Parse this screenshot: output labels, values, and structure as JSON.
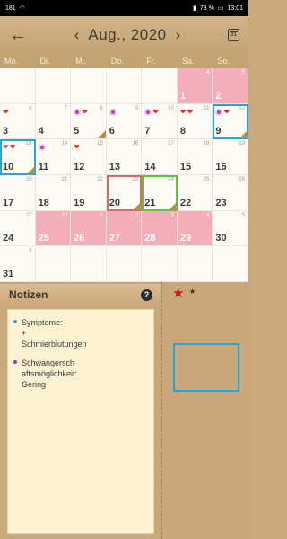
{
  "status_bar": {
    "left_text": "181",
    "battery": "73 %",
    "time": "13:01"
  },
  "header": {
    "month_title": "Aug., 2020",
    "prev": "‹",
    "next": "›",
    "calendar_icon_text": "31",
    "back_icon": "←"
  },
  "weekdays": [
    "Mo.",
    "Di.",
    "Mi.",
    "Do.",
    "Fr.",
    "Sa.",
    "So."
  ],
  "calendar_rows": [
    [
      {
        "day": "",
        "cycle": ""
      },
      {
        "day": "",
        "cycle": ""
      },
      {
        "day": "",
        "cycle": ""
      },
      {
        "day": "",
        "cycle": ""
      },
      {
        "day": "",
        "cycle": ""
      },
      {
        "day": "1",
        "cycle": "4",
        "pink": true
      },
      {
        "day": "2",
        "cycle": "5",
        "pink": true
      }
    ],
    [
      {
        "day": "3",
        "cycle": "6",
        "symbols": [
          "heart"
        ]
      },
      {
        "day": "4",
        "cycle": "7"
      },
      {
        "day": "5",
        "cycle": "8",
        "symbols": [
          "ring",
          "heart"
        ],
        "fold": true
      },
      {
        "day": "6",
        "cycle": "9",
        "symbols": [
          "ring"
        ]
      },
      {
        "day": "7",
        "cycle": "10",
        "symbols": [
          "ring",
          "heart"
        ]
      },
      {
        "day": "8",
        "cycle": "11",
        "symbols": [
          "heart",
          "heart"
        ]
      },
      {
        "day": "9",
        "cycle": "12",
        "symbols": [
          "ring",
          "heart"
        ],
        "fold": true,
        "highlight": "blue"
      }
    ],
    [
      {
        "day": "10",
        "cycle": "13",
        "symbols": [
          "heart-pink",
          "heart"
        ],
        "fold": true,
        "highlight": "blue"
      },
      {
        "day": "11",
        "cycle": "14",
        "symbols": [
          "ring"
        ]
      },
      {
        "day": "12",
        "cycle": "15",
        "symbols": [
          "heart"
        ]
      },
      {
        "day": "13",
        "cycle": "16"
      },
      {
        "day": "14",
        "cycle": "17"
      },
      {
        "day": "15",
        "cycle": "18"
      },
      {
        "day": "16",
        "cycle": "19"
      }
    ],
    [
      {
        "day": "17",
        "cycle": "20"
      },
      {
        "day": "18",
        "cycle": "21"
      },
      {
        "day": "19",
        "cycle": "22"
      },
      {
        "day": "20",
        "cycle": "23",
        "fold": true,
        "highlight": "red"
      },
      {
        "day": "21",
        "cycle": "24",
        "fold": true,
        "highlight": "green"
      },
      {
        "day": "22",
        "cycle": "25"
      },
      {
        "day": "23",
        "cycle": "26"
      }
    ],
    [
      {
        "day": "24",
        "cycle": "27"
      },
      {
        "day": "25",
        "cycle": "28",
        "pink": true
      },
      {
        "day": "26",
        "cycle": "1",
        "pink": true
      },
      {
        "day": "27",
        "cycle": "2",
        "pink": true
      },
      {
        "day": "28",
        "cycle": "3",
        "pink": true
      },
      {
        "day": "29",
        "cycle": "4",
        "pink": true
      },
      {
        "day": "30",
        "cycle": "5"
      }
    ],
    [
      {
        "day": "31",
        "cycle": "6"
      },
      {
        "day": "",
        "cycle": ""
      },
      {
        "day": "",
        "cycle": ""
      },
      {
        "day": "",
        "cycle": ""
      },
      {
        "day": "",
        "cycle": ""
      },
      {
        "day": "",
        "cycle": ""
      },
      {
        "day": "",
        "cycle": ""
      }
    ]
  ],
  "notes": {
    "title": "Notizen",
    "help_label": "?",
    "items": [
      {
        "color": "#3aa0d8",
        "text": "Symptome:\n+\nSchmierblutungen"
      },
      {
        "color": "#9b3bb0",
        "text": "Schwangersch\naftsmöglichkeit:\nGering"
      }
    ]
  },
  "side_panel": {
    "star_red": "★",
    "star_small": "★"
  },
  "colors": {
    "pink_day": "#f3aeba",
    "heart": "#d6332c",
    "ring": "#c63ca8",
    "highlight_blue": "#2aa3dc",
    "highlight_red": "#d46a6a",
    "highlight_green": "#5cc33c"
  }
}
